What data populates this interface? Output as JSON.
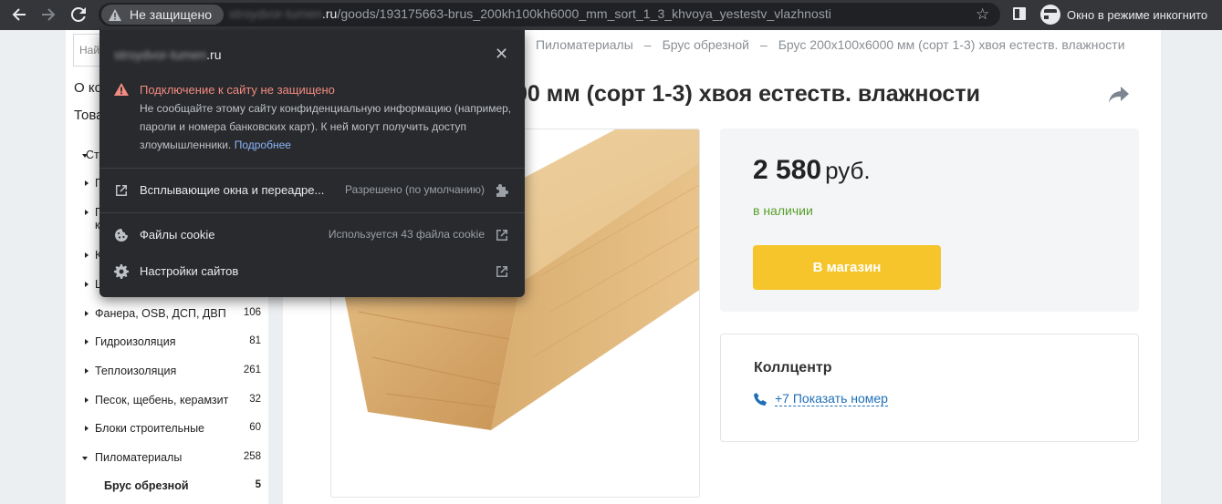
{
  "browser": {
    "security_chip": "Не защищено",
    "url_blurred": "stroydvor-tumen",
    "url_domain": ".ru",
    "url_path": "/goods/193175663-brus_200kh100kh6000_mm_sort_1_3_khvoya_yestestv_vlazhnosti",
    "incognito_label": "Окно в режиме инкогнито"
  },
  "popup": {
    "domain_blurred": "stroydvor-tumen",
    "domain_suffix": ".ru",
    "warning_title": "Подключение к сайту не защищено",
    "warning_text": "Не сообщайте этому сайту конфиденциальную информацию (например, пароли и номера банковских карт). К ней могут получить доступ злоумышленники.",
    "more_link": "Подробнее",
    "rows": [
      {
        "label": "Всплывающие окна и переадре...",
        "value": "Разрешено (по умолчанию)",
        "icon": "external-window-icon",
        "end_icon": "puzzle-icon"
      },
      {
        "label": "Файлы cookie",
        "value": "Используется 43 файла cookie",
        "icon": "cookie-icon",
        "end_icon": "open-external-icon"
      },
      {
        "label": "Настройки сайтов",
        "value": "",
        "icon": "gear-icon",
        "end_icon": "open-external-icon"
      }
    ]
  },
  "sidebar": {
    "search_placeholder": "Най",
    "about_label": "О ко",
    "goods_label": "Това",
    "categories": [
      {
        "name": "Ст",
        "count": "",
        "expanded": true
      },
      {
        "name": "П",
        "count": ""
      },
      {
        "name": "П",
        "count": "",
        "extra": "к"
      },
      {
        "name": "К",
        "count": ""
      },
      {
        "name": "Ц",
        "count": ""
      },
      {
        "name": "Фанера, OSB, ДСП, ДВП",
        "count": "106"
      },
      {
        "name": "Гидроизоляция",
        "count": "81"
      },
      {
        "name": "Теплоизоляция",
        "count": "261"
      },
      {
        "name": "Песок, щебень, керамзит",
        "count": "32"
      },
      {
        "name": "Блоки строительные",
        "count": "60"
      },
      {
        "name": "Пиломатериалы",
        "count": "258",
        "expanded": true
      },
      {
        "name": "Брус обрезной",
        "count": "5",
        "sub": true
      }
    ]
  },
  "main": {
    "breadcrumb": [
      "Пиломатериалы",
      "Брус обрезной",
      "Брус 200х100х6000 мм (сорт 1-3) хвоя естеств. влажности"
    ],
    "breadcrumb_sep": "–",
    "title_visible": "00 мм (сорт 1-3) хвоя естеств. влажности",
    "price": "2 580",
    "currency": "руб.",
    "stock": "в наличии",
    "shop_button": "В магазин",
    "callcenter_title": "Коллцентр",
    "phone_link": "+7 Показать номер",
    "colors": {
      "accent_yellow": "#f5c52b",
      "stock_green": "#5aa02c",
      "link_blue": "#1e6fb8",
      "warning_red": "#f28b82"
    }
  }
}
